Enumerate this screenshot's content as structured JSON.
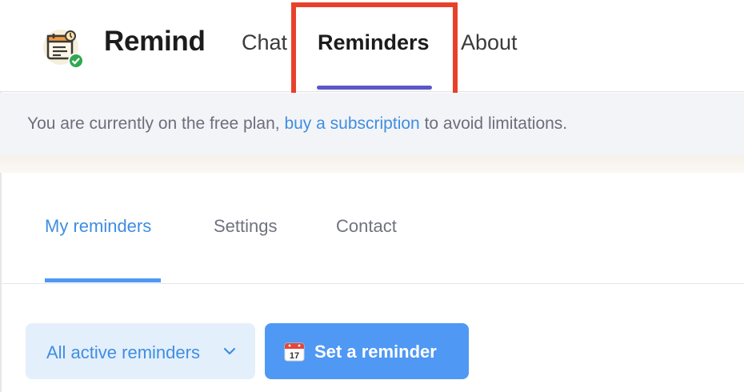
{
  "app": {
    "name": "Remind",
    "logo_icon": "calendar-reminder-icon",
    "colors": {
      "brand_purple": "#5b57c9",
      "accent_blue": "#4f98f4",
      "link_blue": "#3f8ee0",
      "highlight_red": "#e8412b"
    }
  },
  "nav": {
    "tabs": [
      {
        "label": "Chat",
        "active": false
      },
      {
        "label": "Reminders",
        "active": true
      },
      {
        "label": "About",
        "active": false
      }
    ]
  },
  "banner": {
    "prefix": "You are currently on the free plan,",
    "link": "buy a subscription",
    "suffix": "to avoid limitations."
  },
  "subnav": {
    "tabs": [
      {
        "label": "My reminders",
        "active": true
      },
      {
        "label": "Settings",
        "active": false
      },
      {
        "label": "Contact",
        "active": false
      }
    ]
  },
  "controls": {
    "filter": {
      "selected": "All active reminders",
      "icon": "chevron-down-icon"
    },
    "set_reminder": {
      "label": "Set a reminder",
      "icon": "calendar-17-icon"
    }
  }
}
